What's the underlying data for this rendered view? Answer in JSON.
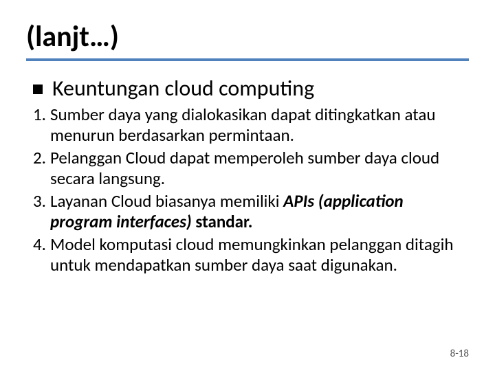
{
  "title": "(lanjt…)",
  "subheading": "Keuntungan cloud computing",
  "items": [
    {
      "num": "1.",
      "text": "Sumber daya yang dialokasikan dapat ditingkatkan atau menurun berdasarkan permintaan."
    },
    {
      "num": "2.",
      "text": "Pelanggan Cloud dapat memperoleh sumber daya cloud secara langsung."
    },
    {
      "num": "3.",
      "pre": "Layanan Cloud biasanya memiliki ",
      "bold": "APIs (application program interfaces)",
      "post": " standar."
    },
    {
      "num": "4.",
      "text": "Model komputasi cloud memungkinkan pelanggan ditagih untuk mendapatkan sumber daya saat digunakan."
    }
  ],
  "footer": "8-18"
}
